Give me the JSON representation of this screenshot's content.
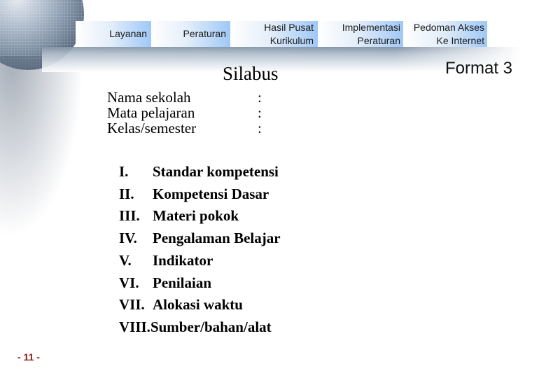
{
  "nav": {
    "items": [
      {
        "line1": "Layanan",
        "line2": ""
      },
      {
        "line1": "Peraturan",
        "line2": ""
      },
      {
        "line1": "Hasil Pusat",
        "line2": "Kurikulum"
      },
      {
        "line1": "Implementasi",
        "line2": "Peraturan"
      },
      {
        "line1": "Pedoman Akses",
        "line2": "Ke Internet"
      }
    ]
  },
  "header": {
    "title": "Silabus",
    "format_label": "Format 3"
  },
  "fields": [
    {
      "label": "Nama sekolah",
      "separator": ":"
    },
    {
      "label": "Mata pelajaran",
      "separator": ":"
    },
    {
      "label": "Kelas/semester",
      "separator": ":"
    }
  ],
  "sections": [
    {
      "number": "I.",
      "label": "Standar kompetensi"
    },
    {
      "number": "II.",
      "label": "Kompetensi Dasar"
    },
    {
      "number": "III.",
      "label": "Materi pokok"
    },
    {
      "number": "IV.",
      "label": "Pengalaman Belajar"
    },
    {
      "number": "V.",
      "label": "Indikator"
    },
    {
      "number": "VI.",
      "label": "Penilaian"
    },
    {
      "number": "VII.",
      "label": "Alokasi waktu"
    },
    {
      "number": "VIII.",
      "label": "Sumber/bahan/alat"
    }
  ],
  "footer": {
    "page_number": "- 11 -"
  },
  "colors": {
    "nav_gradient_end": "#9fc8f7",
    "page_number": "#8b1a1a"
  }
}
